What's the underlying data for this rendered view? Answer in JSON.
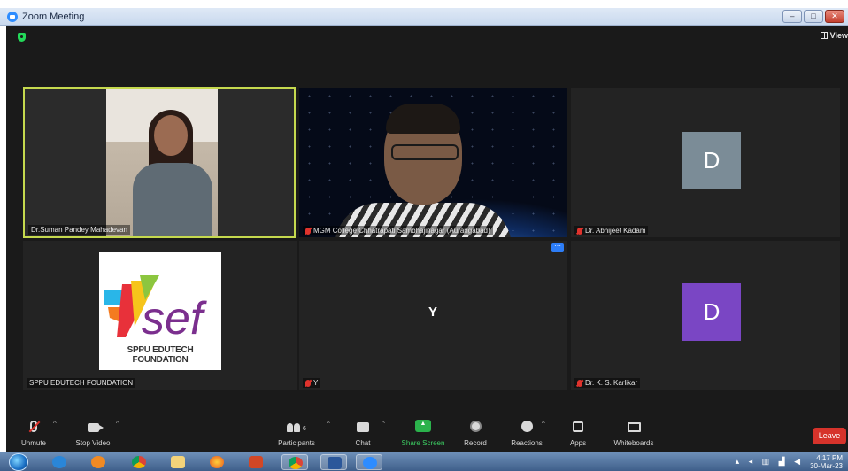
{
  "window": {
    "title": "Zoom Meeting",
    "view_label": "View",
    "controls": {
      "minimize": "–",
      "maximize": "□",
      "close": "✕"
    }
  },
  "tiles": [
    {
      "name": "Dr.Suman Pandey Mahadevan",
      "type": "video",
      "active_speaker": true,
      "muted": false
    },
    {
      "name": "MGM College Chhatrapati Sambhajinagar (Aurangabad)",
      "type": "video",
      "muted": true
    },
    {
      "name": "Dr. Abhijeet Kadam",
      "type": "avatar",
      "avatar_letter": "D",
      "avatar_color": "#7b8c97",
      "muted": true
    },
    {
      "name": "SPPU EDUTECH FOUNDATION",
      "type": "logo",
      "logo_text": "sef",
      "logo_caption": "SPPU EDUTECH FOUNDATION",
      "muted": false
    },
    {
      "name": "Y",
      "type": "letter",
      "avatar_letter": "Y",
      "muted": true,
      "has_more_button": true
    },
    {
      "name": "Dr. K. S. Karlikar",
      "type": "avatar",
      "avatar_letter": "D",
      "avatar_color": "#7a46c4",
      "muted": true
    }
  ],
  "toolbar": {
    "unmute": "Unmute",
    "stop_video": "Stop Video",
    "participants": "Participants",
    "participants_count": "6",
    "chat": "Chat",
    "share_screen": "Share Screen",
    "record": "Record",
    "reactions": "Reactions",
    "apps": "Apps",
    "whiteboards": "Whiteboards",
    "leave": "Leave"
  },
  "taskbar": {
    "apps": [
      "internet-explorer",
      "media-player",
      "chrome",
      "file-explorer",
      "firefox",
      "powerpoint",
      "chrome",
      "word",
      "zoom"
    ],
    "time": "4:17 PM",
    "date": "30-Mar-23"
  },
  "colors": {
    "meeting_bg": "#1a1a1a",
    "active_speaker_border": "#c5d94e",
    "share_green": "#2bb24c",
    "leave_red": "#d6332b"
  }
}
